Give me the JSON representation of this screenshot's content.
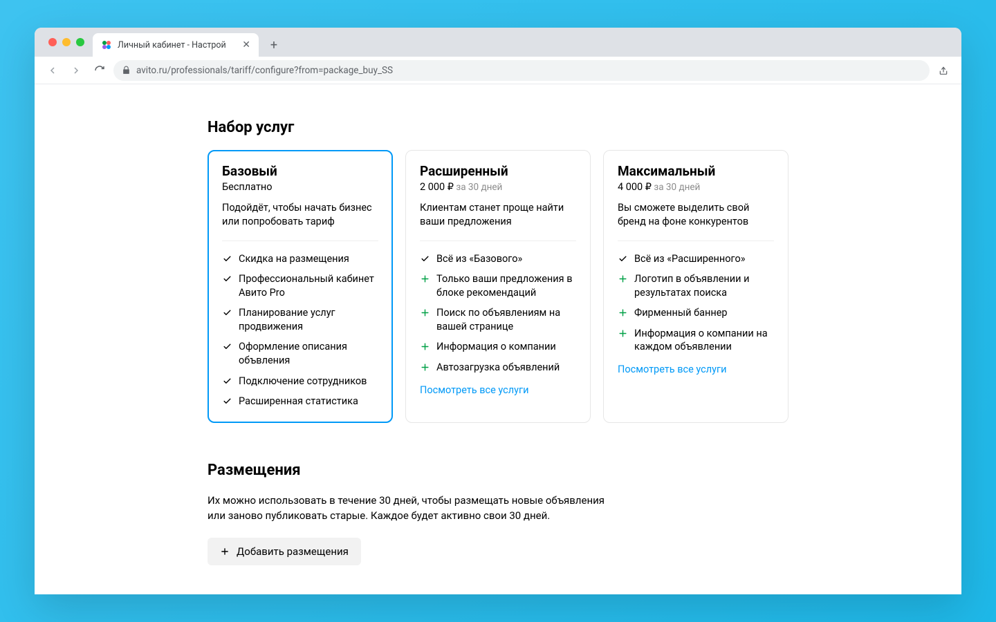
{
  "browser": {
    "tab_title": "Личный кабинет - Настрой",
    "url_host": "avito.ru",
    "url_path": "/professionals/tariff/configure?from=package_buy_SS"
  },
  "services": {
    "title": "Набор услуг",
    "view_all_label": "Посмотреть все услуги",
    "plans": [
      {
        "title": "Базовый",
        "price": "",
        "price_label": "Бесплатно",
        "period": "",
        "desc": "Подойдёт, чтобы начать бизнес или попробовать тариф",
        "features": [
          {
            "type": "check",
            "text": "Скидка на размещения"
          },
          {
            "type": "check",
            "text": "Профессиональный кабинет Авито Pro"
          },
          {
            "type": "check",
            "text": "Планирование услуг продвижения"
          },
          {
            "type": "check",
            "text": "Оформление описания объвления"
          },
          {
            "type": "check",
            "text": "Подключение сотрудников"
          },
          {
            "type": "check",
            "text": "Расширенная статистика"
          }
        ],
        "show_link": false,
        "selected": true
      },
      {
        "title": "Расширенный",
        "price": "2 000",
        "price_label": "",
        "period": "за 30 дней",
        "desc": "Клиентам станет проще найти ваши предложения",
        "features": [
          {
            "type": "check",
            "text": "Всё из «Базового»"
          },
          {
            "type": "plus",
            "text": "Только ваши предложения в блоке рекомендаций"
          },
          {
            "type": "plus",
            "text": "Поиск по объявлениям на вашей странице"
          },
          {
            "type": "plus",
            "text": "Информация о компании"
          },
          {
            "type": "plus",
            "text": "Автозагрузка объявлений"
          }
        ],
        "show_link": true,
        "selected": false
      },
      {
        "title": "Максимальный",
        "price": "4 000",
        "price_label": "",
        "period": "за 30 дней",
        "desc": "Вы сможете выделить свой бренд на фоне конкурентов",
        "features": [
          {
            "type": "check",
            "text": "Всё из «Расширенного»"
          },
          {
            "type": "plus",
            "text": "Логотип в объявлении и результатах поиска"
          },
          {
            "type": "plus",
            "text": "Фирменный баннер"
          },
          {
            "type": "plus",
            "text": "Информация о компании на каждом объявлении"
          }
        ],
        "show_link": true,
        "selected": false
      }
    ]
  },
  "placements": {
    "title": "Размещения",
    "desc": "Их можно использовать в течение 30 дней, чтобы размещать новые объявления или заново публиковать старые. Каждое будет активно свои 30 дней.",
    "add_button": "Добавить размещения"
  }
}
